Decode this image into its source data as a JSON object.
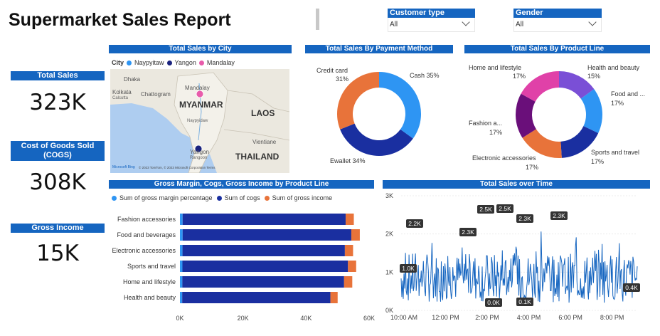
{
  "header": {
    "title": "Supermarket Sales Report"
  },
  "filters": {
    "customer_type": {
      "label": "Customer type",
      "value": "All"
    },
    "gender": {
      "label": "Gender",
      "value": "All"
    }
  },
  "kpis": {
    "total_sales": {
      "label": "Total Sales",
      "value": "323K"
    },
    "cogs": {
      "label": "Cost of Goods Sold (COGS)",
      "value": "308K"
    },
    "gross_income": {
      "label": "Gross Income",
      "value": "15K"
    }
  },
  "map_card": {
    "title": "Total Sales by City",
    "legend_title": "City",
    "cities": [
      {
        "name": "Naypyitaw",
        "color": "#2e95f3"
      },
      {
        "name": "Yangon",
        "color": "#1a237e"
      },
      {
        "name": "Mandalay",
        "color": "#e85cab"
      }
    ],
    "places": {
      "myanmar": "MYANMAR",
      "laos": "LAOS",
      "thailand": "THAILAND",
      "dhaka": "Dhaka",
      "kolkata": "Kolkata",
      "calcutta": "Calcutta",
      "chattogram": "Chattogram",
      "mandalay": "Mandalay",
      "naypyidaw": "Naypyidaw",
      "yangon": "Yangon",
      "rangoon": "Rangoon",
      "vientiane": "Vientiane"
    },
    "attribution": "© 2023 TomTom, © 2023 Microsoft Corporation Terms",
    "logo": "Microsoft Bing"
  },
  "payment_card": {
    "title": "Total Sales By Payment Method",
    "labels": {
      "credit": "Credit card",
      "credit_pct": "31%",
      "cash": "Cash 35%",
      "ewallet": "Ewallet 34%"
    }
  },
  "product_card": {
    "title": "Total Sales By Product Line",
    "labels": {
      "home": "Home and lifestyle",
      "home_pct": "17%",
      "health": "Health and beauty",
      "health_pct": "15%",
      "food": "Food and ...",
      "food_pct": "17%",
      "fashion": "Fashion a...",
      "fashion_pct": "17%",
      "electronic": "Electronic accessories",
      "electronic_pct": "17%",
      "sports": "Sports and travel",
      "sports_pct": "17%"
    }
  },
  "bar_card": {
    "title": "Gross Margin, Cogs, Gross Income by Product Line",
    "legend": [
      {
        "name": "Sum of gross margin percentage",
        "color": "#2e95f3"
      },
      {
        "name": "Sum of cogs",
        "color": "#1a2fa0"
      },
      {
        "name": "Sum of gross income",
        "color": "#e8733a"
      }
    ]
  },
  "line_card": {
    "title": "Total Sales over Time"
  },
  "chart_data": [
    {
      "type": "pie",
      "title": "Total Sales By Payment Method",
      "categories": [
        "Cash",
        "Ewallet",
        "Credit card"
      ],
      "values": [
        35,
        34,
        31
      ],
      "colors": [
        "#2e95f3",
        "#1a2fa0",
        "#e8733a"
      ]
    },
    {
      "type": "pie",
      "title": "Total Sales By Product Line",
      "categories": [
        "Health and beauty",
        "Food and beverages",
        "Sports and travel",
        "Electronic accessories",
        "Fashion accessories",
        "Home and lifestyle"
      ],
      "values": [
        15,
        17,
        17,
        17,
        17,
        17
      ],
      "colors": [
        "#7a4fd6",
        "#2e95f3",
        "#1a2fa0",
        "#e8733a",
        "#6a0f7a",
        "#e041a8"
      ]
    },
    {
      "type": "bar",
      "orientation": "horizontal",
      "title": "Gross Margin, Cogs, Gross Income by Product Line",
      "categories": [
        "Fashion accessories",
        "Food and beverages",
        "Electronic accessories",
        "Sports and travel",
        "Home and lifestyle",
        "Health and beauty"
      ],
      "series": [
        {
          "name": "Sum of gross margin percentage",
          "values": [
            850,
            850,
            810,
            790,
            760,
            720
          ]
        },
        {
          "name": "Sum of cogs",
          "values": [
            51700,
            53500,
            51500,
            52500,
            51300,
            47000
          ]
        },
        {
          "name": "Sum of gross income",
          "values": [
            2600,
            2700,
            2600,
            2600,
            2600,
            2300
          ]
        }
      ],
      "xlim": [
        0,
        60000
      ],
      "xticks": [
        "0K",
        "20K",
        "40K",
        "60K"
      ]
    },
    {
      "type": "line",
      "title": "Total Sales over Time",
      "xticks": [
        "10:00 AM",
        "12:00 PM",
        "2:00 PM",
        "4:00 PM",
        "6:00 PM",
        "8:00 PM"
      ],
      "yticks": [
        "0K",
        "1K",
        "2K",
        "3K"
      ],
      "ylim": [
        0,
        3000
      ],
      "annotations": [
        "1.0K",
        "2.2K",
        "2.3K",
        "0.0K",
        "2.5K",
        "2.5K",
        "0.1K",
        "2.3K",
        "2.3K",
        "0.4K"
      ]
    }
  ]
}
